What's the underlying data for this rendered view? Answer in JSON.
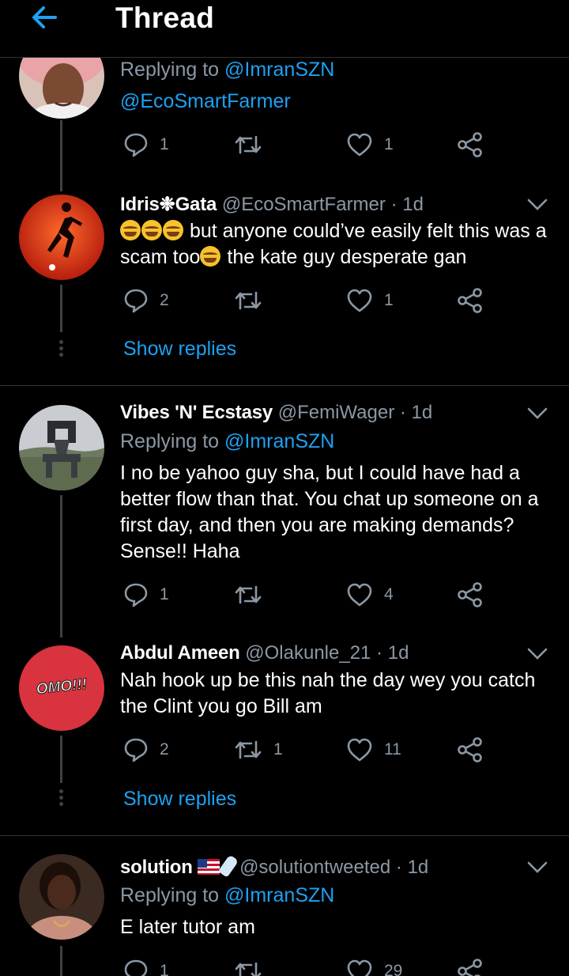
{
  "header": {
    "title": "Thread"
  },
  "tweets": [
    {
      "reply_prefix": "Replying to ",
      "reply_to": "@ImranSZN",
      "body": "@EcoSmartFarmer",
      "replies": "1",
      "retweets": "",
      "likes": "1"
    },
    {
      "name": "Idris❉Gata",
      "handle": "@EcoSmartFarmer",
      "sep": "·",
      "time": "1d",
      "body_part1": " but anyone could’ve easily felt this was a scam too",
      "body_part2": " the kate guy desperate gan",
      "replies": "2",
      "retweets": "",
      "likes": "1",
      "show_replies": "Show replies"
    },
    {
      "name": "Vibes 'N' Ecstasy",
      "handle": "@FemiWager",
      "sep": "·",
      "time": "1d",
      "reply_prefix": "Replying to ",
      "reply_to": "@ImranSZN",
      "body": "I no be yahoo guy sha, but I could have had a better flow than that. You chat up someone on a first day, and then you are making demands? Sense!! Haha",
      "replies": "1",
      "retweets": "",
      "likes": "4"
    },
    {
      "name": "Abdul Ameen",
      "handle": "@Olakunle_21",
      "sep": "·",
      "time": "1d",
      "avatar_text": "OMO!!!",
      "body": "Nah hook up be this nah the day wey you catch the Clint you go Bill am",
      "replies": "2",
      "retweets": "1",
      "likes": "11",
      "show_replies": "Show replies"
    },
    {
      "name": "solution",
      "handle": "@solutiontweeted",
      "sep": "·",
      "time": "1d",
      "reply_prefix": "Replying to ",
      "reply_to": "@ImranSZN",
      "body": "E later tutor am",
      "replies": "1",
      "retweets": "",
      "likes": "29"
    }
  ],
  "colors": {
    "accent": "#1da1f2",
    "muted": "#8b98a5",
    "background": "#000000"
  },
  "icons": {
    "back": "arrow-left-icon",
    "reply": "reply-bubble-icon",
    "retweet": "retweet-icon",
    "like": "heart-icon",
    "share": "share-icon",
    "more": "chevron-down-icon"
  }
}
